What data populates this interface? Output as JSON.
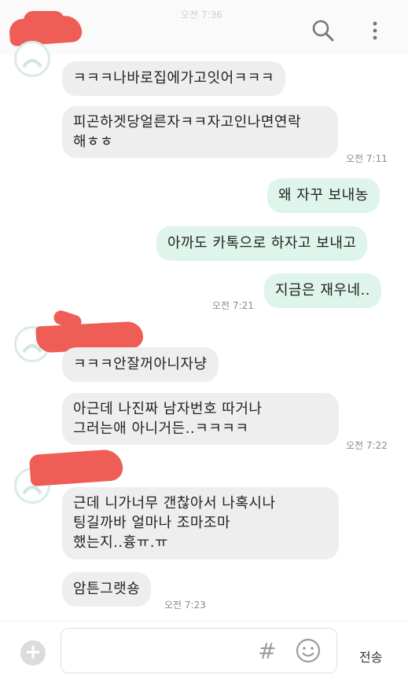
{
  "header": {
    "status_ghost": "오전 7:36",
    "redact_color": "#ef5d57"
  },
  "messages": [
    {
      "side": "recv",
      "text": "ㅋㅋㅋ나바로집에가고잇어ㅋㅋㅋ"
    },
    {
      "side": "recv",
      "lines": [
        "피곤하겟당얼른자ㅋㅋ자고인나면연락",
        "해ㅎㅎ"
      ]
    },
    {
      "time": "오전 7:11"
    },
    {
      "side": "sent",
      "text": "왜 자꾸 보내농"
    },
    {
      "side": "sent",
      "text": "아까도 카톡으로 하자고 보내고"
    },
    {
      "side": "sent",
      "text": "지금은 재우네.."
    },
    {
      "time": "오전 7:21"
    },
    {
      "side": "recv",
      "text": "ㅋㅋㅋ안잘꺼아니자냥"
    },
    {
      "side": "recv",
      "lines": [
        "아근데 나진짜 남자번호 따거나",
        "그러는애 아니거든..ㅋㅋㅋㅋ"
      ]
    },
    {
      "time": "오전 7:22"
    },
    {
      "side": "recv",
      "lines": [
        "근데 니가너무 갠찮아서 나혹시나",
        "팅길까바 얼마나 조마조마",
        "했는지..흉ㅠ.ㅠ"
      ]
    },
    {
      "side": "recv",
      "text": "암튼그랫숑"
    },
    {
      "time": "오전 7:23"
    }
  ],
  "composer": {
    "hash_symbol": "#",
    "send_label": "전송",
    "plus_symbol": "+"
  }
}
